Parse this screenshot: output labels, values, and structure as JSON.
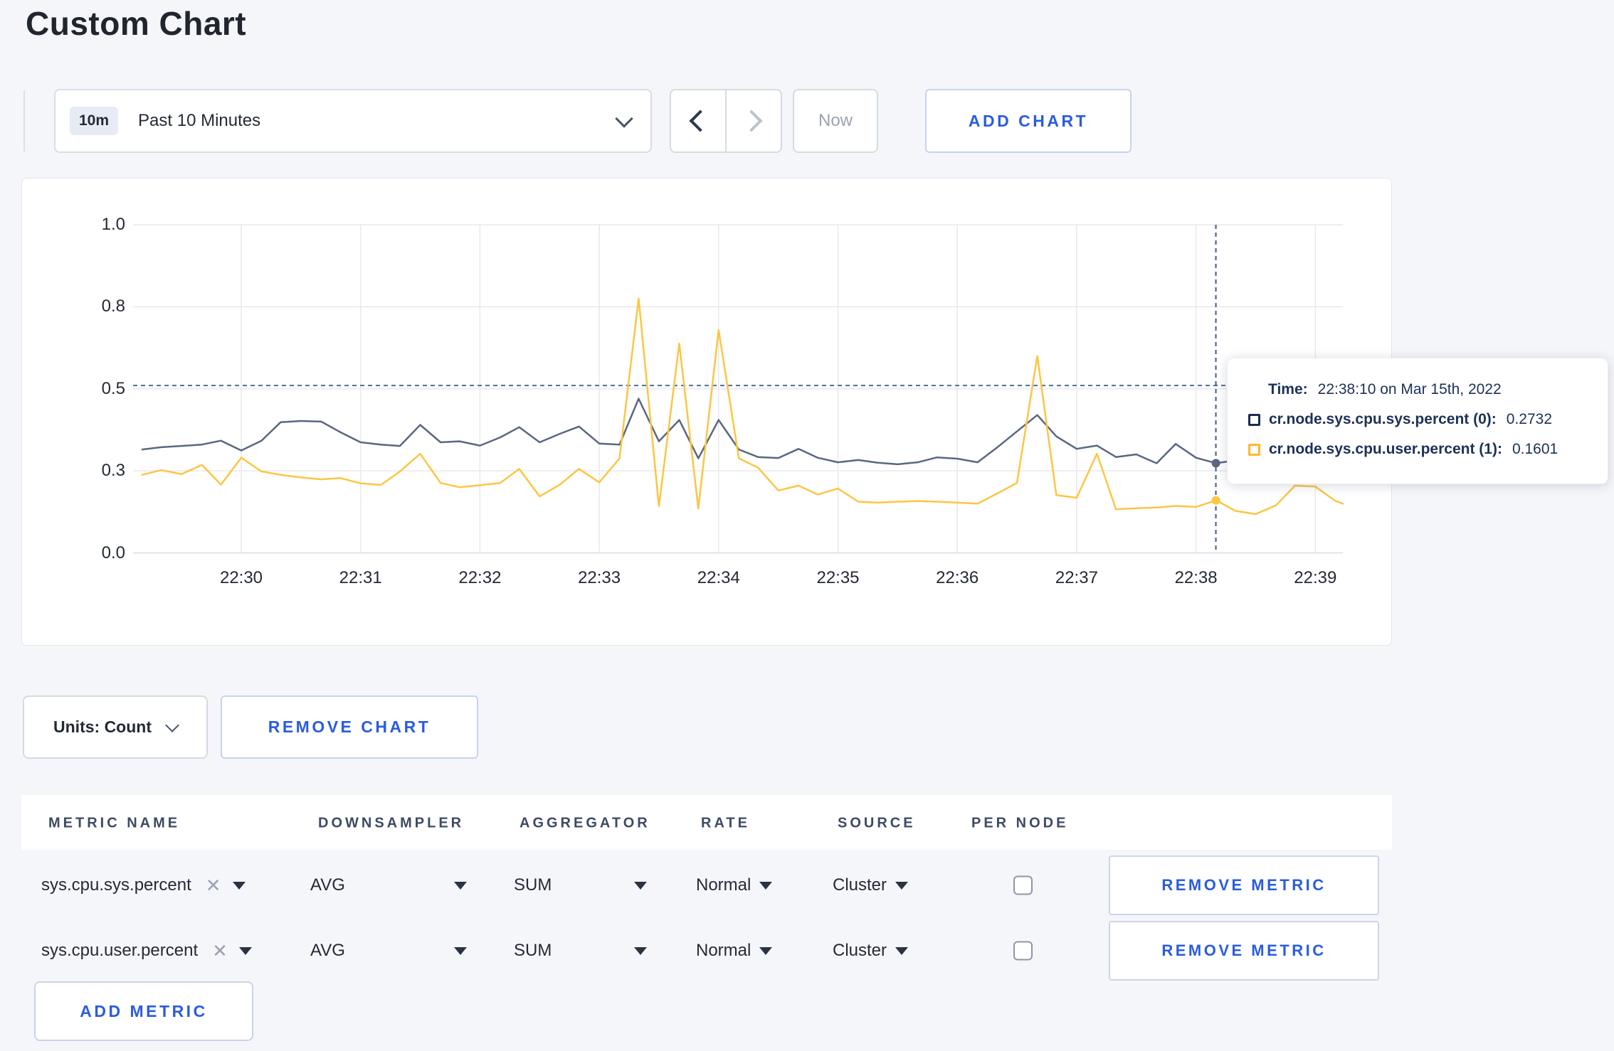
{
  "page": {
    "title": "Custom Chart"
  },
  "toolbar": {
    "time_range": {
      "badge": "10m",
      "label": "Past 10 Minutes"
    },
    "now_label": "Now",
    "add_chart_label": "ADD CHART"
  },
  "chart_data": {
    "type": "line",
    "title": "",
    "xlabel": "",
    "ylabel": "",
    "ylim": [
      0,
      1
    ],
    "grid": true,
    "x_domain_minutes_after_2200": [
      29.09,
      39.25
    ],
    "y_ticks": [
      {
        "v": 0.0,
        "label": "0.0"
      },
      {
        "v": 0.25,
        "label": "0.3"
      },
      {
        "v": 0.5,
        "label": "0.5"
      },
      {
        "v": 0.75,
        "label": "0.8"
      },
      {
        "v": 1.0,
        "label": "1.0"
      }
    ],
    "x_ticks": [
      {
        "t": 30,
        "label": "22:30"
      },
      {
        "t": 31,
        "label": "22:31"
      },
      {
        "t": 32,
        "label": "22:32"
      },
      {
        "t": 33,
        "label": "22:33"
      },
      {
        "t": 34,
        "label": "22:34"
      },
      {
        "t": 35,
        "label": "22:35"
      },
      {
        "t": 36,
        "label": "22:36"
      },
      {
        "t": 37,
        "label": "22:37"
      },
      {
        "t": 38,
        "label": "22:38"
      },
      {
        "t": 39,
        "label": "22:39"
      }
    ],
    "series": [
      {
        "name": "cr.node.sys.cpu.sys.percent",
        "color": "#5a6780",
        "points": [
          [
            29.17,
            0.315
          ],
          [
            29.33,
            0.322
          ],
          [
            29.5,
            0.326
          ],
          [
            29.67,
            0.33
          ],
          [
            29.83,
            0.342
          ],
          [
            30.0,
            0.312
          ],
          [
            30.17,
            0.342
          ],
          [
            30.33,
            0.398
          ],
          [
            30.5,
            0.402
          ],
          [
            30.67,
            0.4
          ],
          [
            30.83,
            0.368
          ],
          [
            31.0,
            0.337
          ],
          [
            31.17,
            0.33
          ],
          [
            31.33,
            0.326
          ],
          [
            31.5,
            0.39
          ],
          [
            31.67,
            0.337
          ],
          [
            31.83,
            0.34
          ],
          [
            32.0,
            0.327
          ],
          [
            32.17,
            0.352
          ],
          [
            32.33,
            0.383
          ],
          [
            32.5,
            0.337
          ],
          [
            32.67,
            0.363
          ],
          [
            32.83,
            0.385
          ],
          [
            33.0,
            0.333
          ],
          [
            33.17,
            0.33
          ],
          [
            33.33,
            0.47
          ],
          [
            33.5,
            0.34
          ],
          [
            33.67,
            0.405
          ],
          [
            33.83,
            0.288
          ],
          [
            34.0,
            0.405
          ],
          [
            34.17,
            0.315
          ],
          [
            34.33,
            0.292
          ],
          [
            34.5,
            0.289
          ],
          [
            34.67,
            0.317
          ],
          [
            34.83,
            0.29
          ],
          [
            35.0,
            0.276
          ],
          [
            35.17,
            0.283
          ],
          [
            35.33,
            0.275
          ],
          [
            35.5,
            0.27
          ],
          [
            35.67,
            0.276
          ],
          [
            35.83,
            0.291
          ],
          [
            36.0,
            0.287
          ],
          [
            36.17,
            0.276
          ],
          [
            36.33,
            0.32
          ],
          [
            36.5,
            0.37
          ],
          [
            36.67,
            0.42
          ],
          [
            36.83,
            0.355
          ],
          [
            37.0,
            0.317
          ],
          [
            37.17,
            0.327
          ],
          [
            37.33,
            0.292
          ],
          [
            37.5,
            0.3
          ],
          [
            37.67,
            0.273
          ],
          [
            37.83,
            0.332
          ],
          [
            38.0,
            0.29
          ],
          [
            38.17,
            0.2732
          ],
          [
            38.33,
            0.282
          ],
          [
            38.5,
            0.287
          ],
          [
            38.67,
            0.292
          ],
          [
            38.83,
            0.295
          ],
          [
            39.0,
            0.29
          ],
          [
            39.17,
            0.293
          ],
          [
            39.23,
            0.29
          ]
        ]
      },
      {
        "name": "cr.node.sys.cpu.user.percent",
        "color": "#fcc644",
        "points": [
          [
            29.17,
            0.238
          ],
          [
            29.33,
            0.252
          ],
          [
            29.5,
            0.24
          ],
          [
            29.67,
            0.268
          ],
          [
            29.83,
            0.208
          ],
          [
            30.0,
            0.29
          ],
          [
            30.17,
            0.248
          ],
          [
            30.33,
            0.238
          ],
          [
            30.5,
            0.23
          ],
          [
            30.67,
            0.224
          ],
          [
            30.83,
            0.228
          ],
          [
            31.0,
            0.212
          ],
          [
            31.17,
            0.207
          ],
          [
            31.33,
            0.248
          ],
          [
            31.5,
            0.302
          ],
          [
            31.67,
            0.213
          ],
          [
            31.83,
            0.2
          ],
          [
            32.0,
            0.206
          ],
          [
            32.17,
            0.213
          ],
          [
            32.33,
            0.256
          ],
          [
            32.5,
            0.172
          ],
          [
            32.67,
            0.208
          ],
          [
            32.83,
            0.256
          ],
          [
            33.0,
            0.215
          ],
          [
            33.17,
            0.288
          ],
          [
            33.33,
            0.775
          ],
          [
            33.5,
            0.142
          ],
          [
            33.67,
            0.638
          ],
          [
            33.83,
            0.135
          ],
          [
            34.0,
            0.679
          ],
          [
            34.17,
            0.288
          ],
          [
            34.33,
            0.26
          ],
          [
            34.5,
            0.19
          ],
          [
            34.67,
            0.205
          ],
          [
            34.83,
            0.178
          ],
          [
            35.0,
            0.196
          ],
          [
            35.17,
            0.156
          ],
          [
            35.33,
            0.153
          ],
          [
            35.5,
            0.156
          ],
          [
            35.67,
            0.158
          ],
          [
            35.83,
            0.156
          ],
          [
            36.0,
            0.153
          ],
          [
            36.17,
            0.15
          ],
          [
            36.33,
            0.18
          ],
          [
            36.5,
            0.213
          ],
          [
            36.67,
            0.6
          ],
          [
            36.83,
            0.176
          ],
          [
            37.0,
            0.168
          ],
          [
            37.17,
            0.302
          ],
          [
            37.33,
            0.133
          ],
          [
            37.5,
            0.136
          ],
          [
            37.67,
            0.138
          ],
          [
            37.83,
            0.143
          ],
          [
            38.0,
            0.14
          ],
          [
            38.17,
            0.1601
          ],
          [
            38.33,
            0.128
          ],
          [
            38.5,
            0.118
          ],
          [
            38.67,
            0.145
          ],
          [
            38.83,
            0.205
          ],
          [
            39.0,
            0.202
          ],
          [
            39.17,
            0.158
          ],
          [
            39.23,
            0.15
          ]
        ]
      }
    ],
    "crosshair": {
      "t": 38.1667,
      "value": 0.51
    },
    "hover_points": [
      {
        "series": 0,
        "t": 38.1667,
        "v": 0.2732
      },
      {
        "series": 1,
        "t": 38.1667,
        "v": 0.1601
      }
    ],
    "legend_position": "tooltip"
  },
  "tooltip": {
    "time_label": "Time:",
    "time_value": "22:38:10 on Mar 15th, 2022",
    "entries": [
      {
        "name": "cr.node.sys.cpu.sys.percent (0):",
        "value": "0.2732",
        "swatch_color": "#1d2c4e"
      },
      {
        "name": "cr.node.sys.cpu.user.percent (1):",
        "value": "0.1601",
        "swatch_color": "#fdb92e"
      }
    ]
  },
  "chart_controls": {
    "units_label": "Units: Count",
    "remove_chart_label": "REMOVE CHART"
  },
  "metrics_table": {
    "headers": [
      "METRIC NAME",
      "DOWNSAMPLER",
      "AGGREGATOR",
      "RATE",
      "SOURCE",
      "PER NODE"
    ],
    "rows": [
      {
        "metric": "sys.cpu.sys.percent",
        "downsampler": "AVG",
        "aggregator": "SUM",
        "rate": "Normal",
        "source": "Cluster",
        "per_node_checked": false,
        "remove_label": "REMOVE METRIC"
      },
      {
        "metric": "sys.cpu.user.percent",
        "downsampler": "AVG",
        "aggregator": "SUM",
        "rate": "Normal",
        "source": "Cluster",
        "per_node_checked": false,
        "remove_label": "REMOVE METRIC"
      }
    ],
    "add_metric_label": "ADD METRIC"
  },
  "colors": {
    "accent_blue": "#2a5cdf",
    "series_sys": "#5a6780",
    "series_user": "#fcc644",
    "crosshair": "#4f6f96",
    "grid": "#e8e9ec",
    "page_background": "#f5f6fa"
  }
}
